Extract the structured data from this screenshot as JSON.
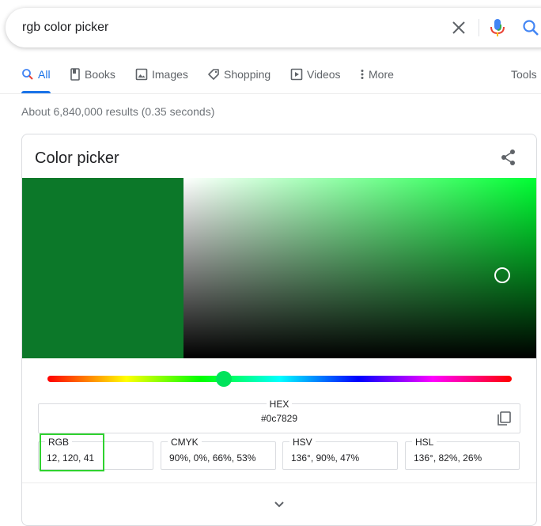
{
  "search": {
    "query": "rgb color picker"
  },
  "icons": {
    "clear": "close-icon",
    "mic": "mic-icon",
    "search": "search-icon",
    "share": "share-icon",
    "copy": "copy-icon",
    "expand": "chevron-down-icon"
  },
  "tabs": [
    {
      "label": "All",
      "icon": "search-icon",
      "active": true
    },
    {
      "label": "Books",
      "icon": "book-icon"
    },
    {
      "label": "Images",
      "icon": "image-icon"
    },
    {
      "label": "Shopping",
      "icon": "tag-icon"
    },
    {
      "label": "Videos",
      "icon": "play-icon"
    },
    {
      "label": "More",
      "icon": "more-vertical-icon"
    }
  ],
  "tools_label": "Tools",
  "result_stats": "About 6,840,000 results (0.35 seconds)",
  "color_picker": {
    "title": "Color picker",
    "selected_color": "#0c7829",
    "hue_color": "#00ff33",
    "hue_fraction": 0.38,
    "hex_label": "HEX",
    "hex_value": "#0c7829",
    "fields": [
      {
        "label": "RGB",
        "value": "12, 120, 41"
      },
      {
        "label": "CMYK",
        "value": "90%, 0%, 66%, 53%"
      },
      {
        "label": "HSV",
        "value": "136°, 90%, 47%"
      },
      {
        "label": "HSL",
        "value": "136°, 82%, 26%"
      }
    ]
  },
  "colors": {
    "accent": "#1a73e8",
    "highlight": "#2fd22f"
  }
}
